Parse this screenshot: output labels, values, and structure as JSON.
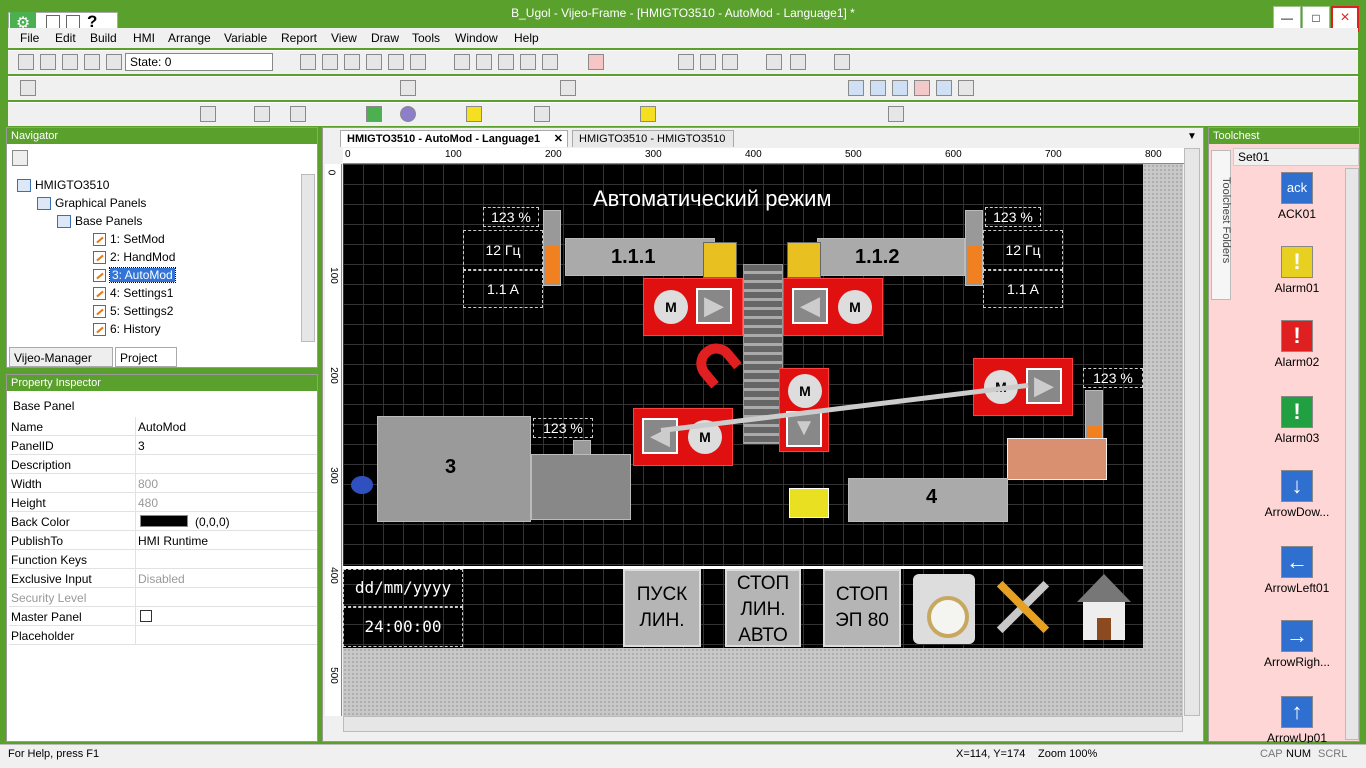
{
  "window": {
    "title": "B_Ugol - Vijeo-Frame - [HMIGTO3510 - AutoMod - Language1] *",
    "buttons": {
      "minimize": "—",
      "restore": "□",
      "close": "×"
    }
  },
  "menu": [
    "File",
    "Edit",
    "Build",
    "HMI",
    "Arrange",
    "Variable",
    "Report",
    "View",
    "Draw",
    "Tools",
    "Window",
    "Help"
  ],
  "toolbar": {
    "state_label": "State: 0"
  },
  "navigator": {
    "title": "Navigator",
    "tree": [
      {
        "label": "HMIGTO3510",
        "level": 0
      },
      {
        "label": "Graphical Panels",
        "level": 1
      },
      {
        "label": "Base Panels",
        "level": 2
      },
      {
        "label": "1: SetMod",
        "level": 3
      },
      {
        "label": "2: HandMod",
        "level": 3
      },
      {
        "label": "3: AutoMod",
        "level": 3,
        "selected": true
      },
      {
        "label": "4: Settings1",
        "level": 3
      },
      {
        "label": "5: Settings2",
        "level": 3
      },
      {
        "label": "6: History",
        "level": 3
      }
    ],
    "tabs": [
      "Vijeo-Manager",
      "Project"
    ]
  },
  "property_inspector": {
    "title": "Property Inspector",
    "header": "Base Panel",
    "rows": [
      {
        "name": "Name",
        "value": "AutoMod"
      },
      {
        "name": "PanelID",
        "value": "3"
      },
      {
        "name": "Description",
        "value": ""
      },
      {
        "name": "Width",
        "value": "800"
      },
      {
        "name": "Height",
        "value": "480"
      },
      {
        "name": "Back Color",
        "value": "(0,0,0)"
      },
      {
        "name": "PublishTo",
        "value": "HMI Runtime"
      },
      {
        "name": "Function Keys",
        "value": ""
      },
      {
        "name": "Exclusive Input",
        "value": "Disabled"
      },
      {
        "name": "Security Level",
        "value": ""
      },
      {
        "name": "Master Panel",
        "value": ""
      },
      {
        "name": "Placeholder",
        "value": ""
      }
    ]
  },
  "document_tabs": [
    "HMIGTO3510 - AutoMod - Language1",
    "HMIGTO3510 - HMIGTO3510"
  ],
  "rulers": {
    "h": [
      "0",
      "100",
      "200",
      "300",
      "400",
      "500",
      "600",
      "700",
      "800"
    ],
    "v": [
      "0",
      "100",
      "200",
      "300",
      "400",
      "500"
    ]
  },
  "hmi": {
    "title": "Автоматический режим",
    "pct": "123 %",
    "freq": "12 Гц",
    "amps": "1.1 A",
    "conv1": "1.1.1",
    "conv2": "1.1.2",
    "motor": "M",
    "machine3": "3",
    "machine4": "4",
    "date": "dd/mm/yyyy",
    "time": "24:00:00",
    "btn_start_l1": "ПУСК",
    "btn_start_l2": "ЛИН.",
    "btn_stop_l1": "СТОП",
    "btn_stop_l2": "ЛИН.",
    "btn_stop_l3": "АВТО",
    "btn_ep_l1": "СТОП",
    "btn_ep_l2": "ЭП 80"
  },
  "toolchest": {
    "title": "Toolchest",
    "set": "Set01",
    "side_label": "Toolchest Folders",
    "items": [
      {
        "label": "ACK01",
        "glyph": "ack",
        "color": "#2f6fd0"
      },
      {
        "label": "Alarm01",
        "glyph": "!",
        "color": "#e8d020"
      },
      {
        "label": "Alarm02",
        "glyph": "!",
        "color": "#e02020"
      },
      {
        "label": "Alarm03",
        "glyph": "!",
        "color": "#20a040"
      },
      {
        "label": "ArrowDow...",
        "glyph": "↓",
        "color": "#2f6fd0"
      },
      {
        "label": "ArrowLeft01",
        "glyph": "←",
        "color": "#2f6fd0"
      },
      {
        "label": "ArrowRigh...",
        "glyph": "→",
        "color": "#2f6fd0"
      },
      {
        "label": "ArrowUp01",
        "glyph": "↑",
        "color": "#2f6fd0"
      }
    ]
  },
  "status": {
    "help": "For Help, press F1",
    "coords": "X=114, Y=174",
    "zoom": "Zoom 100%",
    "cap": "CAP",
    "num": "NUM",
    "scrl": "SCRL"
  },
  "colors": {
    "frame": "#5aa02c",
    "accent_red": "#e01010",
    "level_orange": "#f08020"
  }
}
